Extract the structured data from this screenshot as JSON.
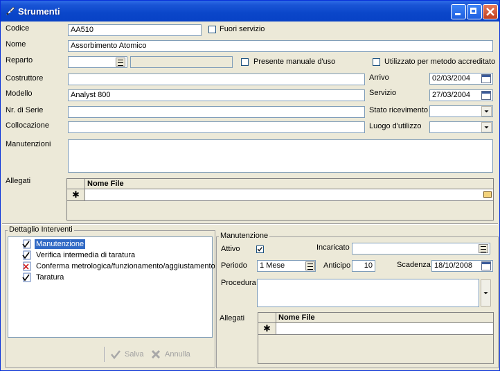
{
  "window": {
    "title": "Strumenti"
  },
  "fields": {
    "codice": {
      "label": "Codice",
      "value": "AA510"
    },
    "fuori_servizio": {
      "label": "Fuori servizio",
      "checked": false
    },
    "nome": {
      "label": "Nome",
      "value": "Assorbimento Atomico"
    },
    "reparto": {
      "label": "Reparto",
      "value": "",
      "description": ""
    },
    "presente_manuale": {
      "label": "Presente manuale d'uso",
      "checked": false
    },
    "utilizzato_metodo": {
      "label": "Utilizzato per metodo accreditato",
      "checked": false
    },
    "costruttore": {
      "label": "Costruttore",
      "value": ""
    },
    "arrivo": {
      "label": "Arrivo",
      "value": "02/03/2004"
    },
    "modello": {
      "label": "Modello",
      "value": "Analyst 800"
    },
    "servizio": {
      "label": "Servizio",
      "value": "27/03/2004"
    },
    "nr_serie": {
      "label": "Nr. di Serie",
      "value": ""
    },
    "stato_ricevimento": {
      "label": "Stato ricevimento",
      "value": ""
    },
    "collocazione": {
      "label": "Collocazione",
      "value": ""
    },
    "luogo_utilizzo": {
      "label": "Luogo d'utilizzo",
      "value": ""
    },
    "manutenzioni": {
      "label": "Manutenzioni",
      "value": ""
    },
    "allegati": {
      "label": "Allegati",
      "column": "Nome File",
      "new_row_marker": "✱"
    }
  },
  "dettaglio": {
    "title": "Dettaglio Interventi",
    "items": [
      {
        "label": "Manutenzione",
        "icon": "check-doc-icon",
        "selected": true
      },
      {
        "label": "Verifica intermedia di taratura",
        "icon": "check-doc-icon",
        "selected": false
      },
      {
        "label": "Conferma metrologica/funzionamento/aggiustamento",
        "icon": "x-doc-icon",
        "selected": false
      },
      {
        "label": "Taratura",
        "icon": "check-doc-icon",
        "selected": false
      }
    ],
    "salva_label": "Salva",
    "annulla_label": "Annulla"
  },
  "manutenzione": {
    "title": "Manutenzione",
    "attivo": {
      "label": "Attivo",
      "checked": true
    },
    "incaricato": {
      "label": "Incaricato",
      "value": ""
    },
    "periodo": {
      "label": "Periodo",
      "value": "1 Mese"
    },
    "anticipo": {
      "label": "Anticipo",
      "value": "10"
    },
    "scadenza": {
      "label": "Scadenza",
      "value": "18/10/2008"
    },
    "procedura": {
      "label": "Procedura",
      "value": ""
    },
    "allegati": {
      "label": "Allegati",
      "column": "Nome File",
      "new_row_marker": "✱"
    }
  },
  "colors": {
    "titlebar": "#0a46c9",
    "selection": "#316ac5",
    "window_bg": "#ece9d8"
  }
}
